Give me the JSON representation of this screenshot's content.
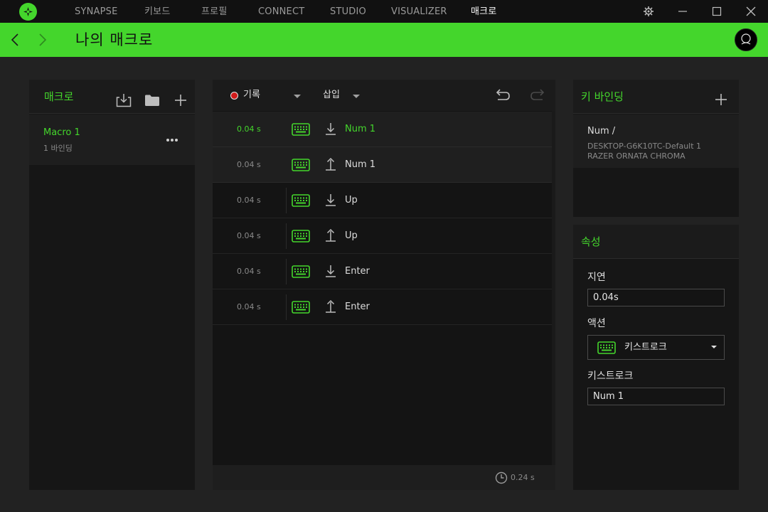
{
  "app": {
    "nav_tabs": [
      {
        "label": "SYNAPSE",
        "active": false
      },
      {
        "label": "키보드",
        "active": false
      },
      {
        "label": "프로필",
        "active": false
      },
      {
        "label": "CONNECT",
        "active": false
      },
      {
        "label": "STUDIO",
        "active": false
      },
      {
        "label": "VISUALIZER",
        "active": false
      },
      {
        "label": "매크로",
        "active": true
      }
    ],
    "accent_color": "#44d62c"
  },
  "header": {
    "title": "나의 매크로"
  },
  "macros_panel": {
    "title": "매크로",
    "items": [
      {
        "name": "Macro 1",
        "sub": "1 바인딩"
      }
    ]
  },
  "editor": {
    "record_label": "기록",
    "insert_label": "삽입",
    "steps": [
      {
        "delay": "0.04 s",
        "key": "Num 1",
        "direction": "down",
        "selected": true
      },
      {
        "delay": "0.04 s",
        "key": "Num 1",
        "direction": "up",
        "selected": true
      },
      {
        "delay": "0.04 s",
        "key": "Up",
        "direction": "down",
        "selected": false
      },
      {
        "delay": "0.04 s",
        "key": "Up",
        "direction": "up",
        "selected": false
      },
      {
        "delay": "0.04 s",
        "key": "Enter",
        "direction": "down",
        "selected": false
      },
      {
        "delay": "0.04 s",
        "key": "Enter",
        "direction": "up",
        "selected": false
      }
    ],
    "total_time": "0.24 s"
  },
  "binding_panel": {
    "title": "키 바인딩",
    "key": "Num /",
    "profile": "DESKTOP-G6K10TC-Default 1",
    "device": "RAZER ORNATA CHROMA"
  },
  "properties": {
    "title": "속성",
    "delay_label": "지연",
    "delay_value": "0.04s",
    "action_label": "액션",
    "action_value": "키스트로크",
    "keystroke_label": "키스트로크",
    "keystroke_value": "Num 1"
  }
}
